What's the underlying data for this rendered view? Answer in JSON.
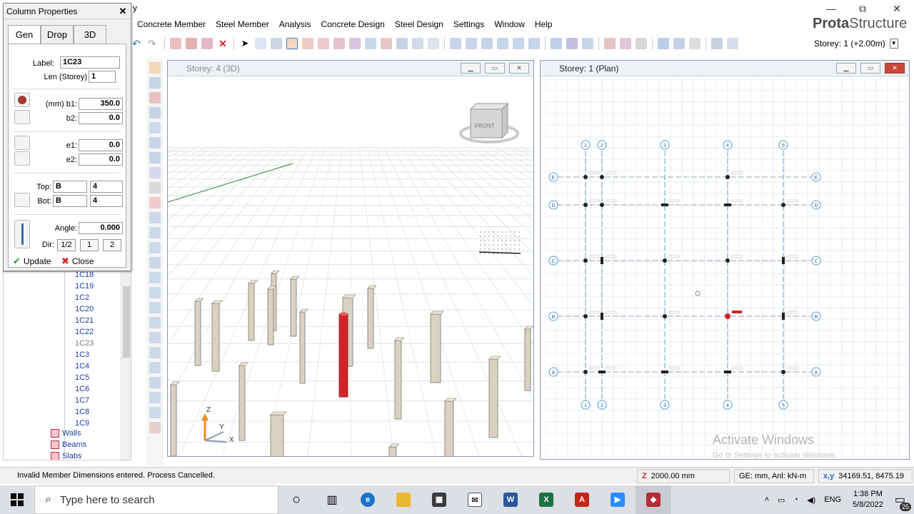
{
  "window": {
    "title_fragment": "y",
    "controls": {
      "minimize": "—",
      "restore": "⧉",
      "close": "✕"
    }
  },
  "menu": [
    "Concrete Member",
    "Steel Member",
    "Analysis",
    "Concrete Design",
    "Steel Design",
    "Settings",
    "Window",
    "Help"
  ],
  "brand": {
    "part1": "Prota",
    "part2": "Structure"
  },
  "storey_selector": {
    "value": "Storey: 1 (+2.00m)"
  },
  "column_properties": {
    "title": "Column Properties",
    "close": "✕",
    "tabs": [
      "Gen",
      "Drop",
      "3D"
    ],
    "active_tab": "Gen",
    "label_lbl": "Label:",
    "label_val": "1C23",
    "len_lbl": "Len (Storey)",
    "len_val": "1",
    "b1_lbl": "(mm) b1:",
    "b1_val": "350.0",
    "b2_lbl": "b2:",
    "b2_val": "0.0",
    "e1_lbl": "e1:",
    "e1_val": "0.0",
    "e2_lbl": "e2:",
    "e2_val": "0.0",
    "top_lbl": "Top:",
    "top_a": "B",
    "top_b": "4",
    "bot_lbl": "Bot:",
    "bot_a": "B",
    "bot_b": "4",
    "angle_lbl": "Angle:",
    "angle_val": "0.000",
    "dir_lbl": "Dir:",
    "dir_opts": [
      "1/2",
      "1",
      "2"
    ],
    "update": "Update",
    "close_btn": "Close"
  },
  "tree": {
    "nodes": [
      "1C18",
      "1C19",
      "1C2",
      "1C20",
      "1C21",
      "1C22",
      "1C23",
      "1C3",
      "1C4",
      "1C5",
      "1C6",
      "1C7",
      "1C8",
      "1C9"
    ],
    "selected": "1C23",
    "categories": [
      "Walls",
      "Beams",
      "Slabs"
    ]
  },
  "view3d": {
    "title": "Storey: 4 (3D)",
    "cube_label": "FRONT",
    "axes": {
      "z": "Z",
      "y": "Y",
      "x": "X"
    }
  },
  "viewplan": {
    "title": "Storey: 1 (Plan)",
    "grid_cols": [
      "1",
      "2",
      "3",
      "4",
      "5"
    ],
    "grid_rows": [
      "E",
      "D",
      "C",
      "B",
      "A"
    ]
  },
  "status": {
    "message": "Invalid Member Dimensions entered. Process Cancelled.",
    "elevation": "2000.00 mm",
    "units": "GE: mm,  Anl: kN-m",
    "coords_lbl": "x,y",
    "coords": "34169.51, 8475.19"
  },
  "watermark": {
    "line1": "Activate Windows",
    "line2": "Go to Settings to activate Windows."
  },
  "taskbar": {
    "search_placeholder": "Type here to search",
    "lang": "ENG",
    "time": "1:38 PM",
    "date": "5/8/2022",
    "notifications": "25"
  },
  "colors": {
    "selected_column": "#d0242a",
    "grid_line": "#5aa0d8",
    "column": "#d9d2c3"
  }
}
